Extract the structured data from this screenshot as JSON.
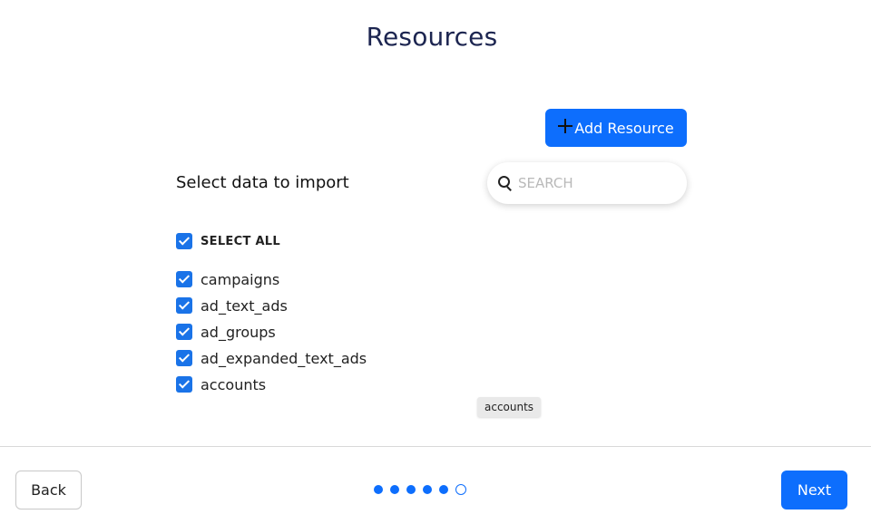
{
  "page": {
    "title": "Resources"
  },
  "toolbar": {
    "add_resource_label": "Add Resource",
    "add_icon": "plus-icon"
  },
  "section": {
    "label": "Select data to import"
  },
  "search": {
    "placeholder": "SEARCH",
    "value": "",
    "icon": "search-icon"
  },
  "select_all": {
    "label": "SELECT ALL",
    "checked": true
  },
  "resources": [
    {
      "label": "campaigns",
      "checked": true
    },
    {
      "label": "ad_text_ads",
      "checked": true
    },
    {
      "label": "ad_groups",
      "checked": true
    },
    {
      "label": "ad_expanded_text_ads",
      "checked": true
    },
    {
      "label": "accounts",
      "checked": true
    }
  ],
  "tooltip": {
    "text": "accounts"
  },
  "footer": {
    "back_label": "Back",
    "next_label": "Next",
    "steps_total": 6,
    "current_step": 6
  },
  "colors": {
    "primary": "#0d6efd",
    "checkbox": "#1a73e8",
    "title": "#1c2550"
  }
}
